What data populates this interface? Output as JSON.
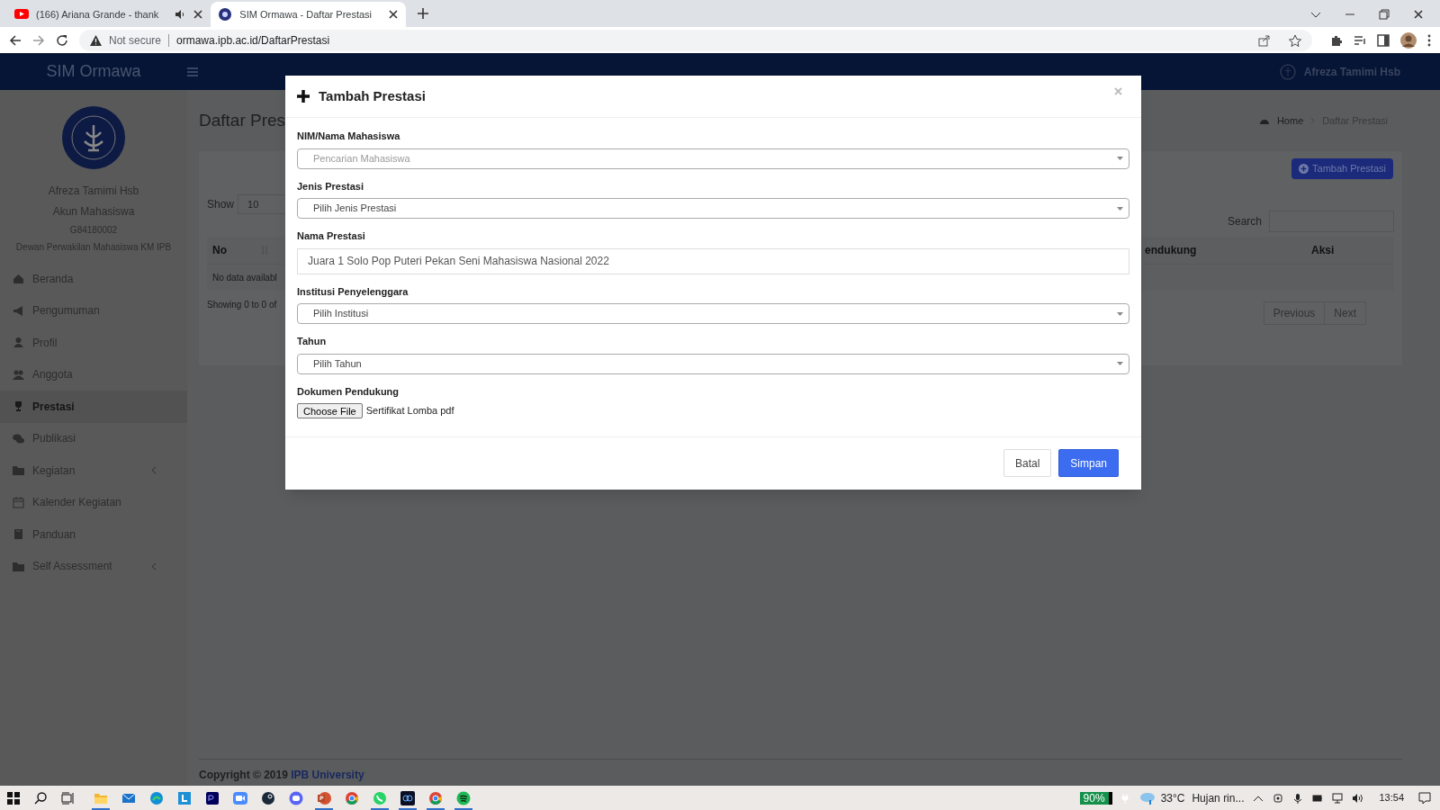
{
  "browser": {
    "tabs": [
      {
        "title": "(166) Ariana Grande - thank",
        "kind": "video",
        "audio": true,
        "selected": false
      },
      {
        "title": "SIM Ormawa - Daftar Prestasi",
        "kind": "site",
        "audio": false,
        "selected": true
      }
    ],
    "security": "Not secure",
    "url": "ormawa.ipb.ac.id/DaftarPrestasi"
  },
  "header": {
    "brand": "SIM Ormawa",
    "user": "Afreza Tamimi Hsb"
  },
  "sidebar": {
    "profile": {
      "name": "Afreza Tamimi Hsb",
      "role": "Akun Mahasiswa",
      "id": "G84180002",
      "org": "Dewan Perwakilan Mahasiswa KM IPB"
    },
    "items": [
      {
        "label": "Beranda",
        "selected": false,
        "submenu": false
      },
      {
        "label": "Pengumuman",
        "selected": false,
        "submenu": false
      },
      {
        "label": "Profil",
        "selected": false,
        "submenu": false
      },
      {
        "label": "Anggota",
        "selected": false,
        "submenu": false
      },
      {
        "label": "Prestasi",
        "selected": true,
        "submenu": false
      },
      {
        "label": "Publikasi",
        "selected": false,
        "submenu": false
      },
      {
        "label": "Kegiatan",
        "selected": false,
        "submenu": true
      },
      {
        "label": "Kalender Kegiatan",
        "selected": false,
        "submenu": false
      },
      {
        "label": "Panduan",
        "selected": false,
        "submenu": false
      },
      {
        "label": "Self Assessment",
        "selected": false,
        "submenu": true
      }
    ]
  },
  "page": {
    "title": "Daftar Pres",
    "breadcrumb": [
      "Home",
      "Daftar Prestasi"
    ],
    "add_button": "Tambah Prestasi",
    "show_label": "Show",
    "show_value": "10",
    "search_label": "Search",
    "table": {
      "columns": [
        "No",
        "endukung",
        "Aksi"
      ],
      "empty": "No data availabl"
    },
    "info": "Showing 0 to 0 of",
    "pagination": [
      "Previous",
      "Next"
    ]
  },
  "footer": {
    "text": "Copyright © 2019",
    "link": "IPB University"
  },
  "modal": {
    "title": "Tambah Prestasi",
    "fields": [
      {
        "label": "NIM/Nama Mahasiswa",
        "kind": "select",
        "placeholder": "Pencarian Mahasiswa"
      },
      {
        "label": "Jenis Prestasi",
        "kind": "select",
        "value": "Pilih Jenis Prestasi"
      },
      {
        "label": "Nama Prestasi",
        "kind": "text",
        "value": "Juara 1 Solo Pop Puteri Pekan Seni Mahasiswa Nasional 2022"
      },
      {
        "label": "Institusi Penyelenggara",
        "kind": "select",
        "value": "Pilih Institusi"
      },
      {
        "label": "Tahun",
        "kind": "select",
        "value": "Pilih Tahun"
      },
      {
        "label": "Dokumen Pendukung",
        "kind": "file",
        "button": "Choose File",
        "value": "Sertifikat Lomba pdf"
      }
    ],
    "buttons": [
      {
        "label": "Batal",
        "kind": "default"
      },
      {
        "label": "Simpan",
        "kind": "primary"
      }
    ]
  },
  "taskbar": {
    "apps": [
      {
        "kind": "explorer",
        "running": true
      },
      {
        "kind": "mail",
        "running": false
      },
      {
        "kind": "edge",
        "running": false
      },
      {
        "kind": "l",
        "running": false
      },
      {
        "kind": "premiere",
        "running": false
      },
      {
        "kind": "zoom",
        "running": false
      },
      {
        "kind": "steam",
        "running": false
      },
      {
        "kind": "discord",
        "running": false
      },
      {
        "kind": "powerpoint",
        "running": true
      },
      {
        "kind": "chrome",
        "running": false
      },
      {
        "kind": "whatsapp",
        "running": true
      },
      {
        "kind": "dark",
        "running": true
      },
      {
        "kind": "chrome",
        "running": true
      },
      {
        "kind": "spotify",
        "running": true
      }
    ],
    "battery": "90%",
    "temperature": "33°C",
    "weather": "Hujan rin...",
    "time": "13:54"
  }
}
